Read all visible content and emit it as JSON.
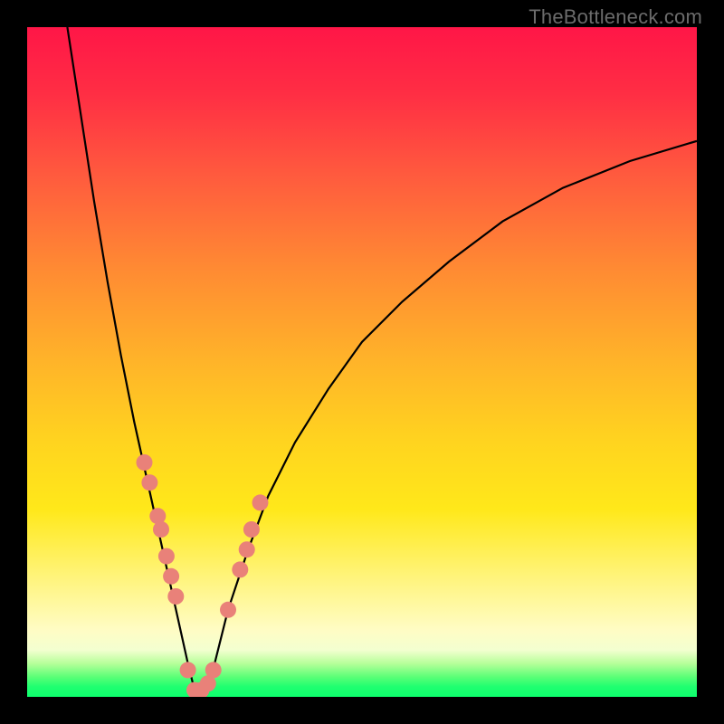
{
  "watermark": "TheBottleneck.com",
  "colors": {
    "frame": "#000000",
    "curve": "#000000",
    "dot": "#e98179",
    "gradient_top": "#ff1647",
    "gradient_bottom": "#0eff6d"
  },
  "chart_data": {
    "type": "line",
    "title": "",
    "xlabel": "",
    "ylabel": "",
    "xlim": [
      0,
      100
    ],
    "ylim": [
      0,
      100
    ],
    "note": "Axes are unlabeled percentages; x≈25 is the minimum where the bottleneck curve touches y≈0. All values read/estimated from pixel positions.",
    "series": [
      {
        "name": "bottleneck-curve",
        "x": [
          6,
          8,
          10,
          12,
          14,
          16,
          18,
          20,
          22,
          24,
          25,
          26,
          28,
          30,
          33,
          36,
          40,
          45,
          50,
          56,
          63,
          71,
          80,
          90,
          100
        ],
        "y": [
          100,
          87,
          74,
          62,
          51,
          41,
          32,
          23,
          14,
          5,
          1,
          1,
          5,
          13,
          22,
          30,
          38,
          46,
          53,
          59,
          65,
          71,
          76,
          80,
          83
        ]
      }
    ],
    "points": {
      "name": "highlighted-dots",
      "x": [
        17.5,
        18.3,
        19.5,
        20.0,
        20.8,
        21.5,
        22.2,
        24.0,
        25.0,
        26.0,
        27.0,
        27.8,
        30.0,
        31.8,
        32.8,
        33.5,
        34.8
      ],
      "y": [
        35.0,
        32.0,
        27.0,
        25.0,
        21.0,
        18.0,
        15.0,
        4.0,
        1.0,
        1.0,
        2.0,
        4.0,
        13.0,
        19.0,
        22.0,
        25.0,
        29.0
      ]
    }
  }
}
